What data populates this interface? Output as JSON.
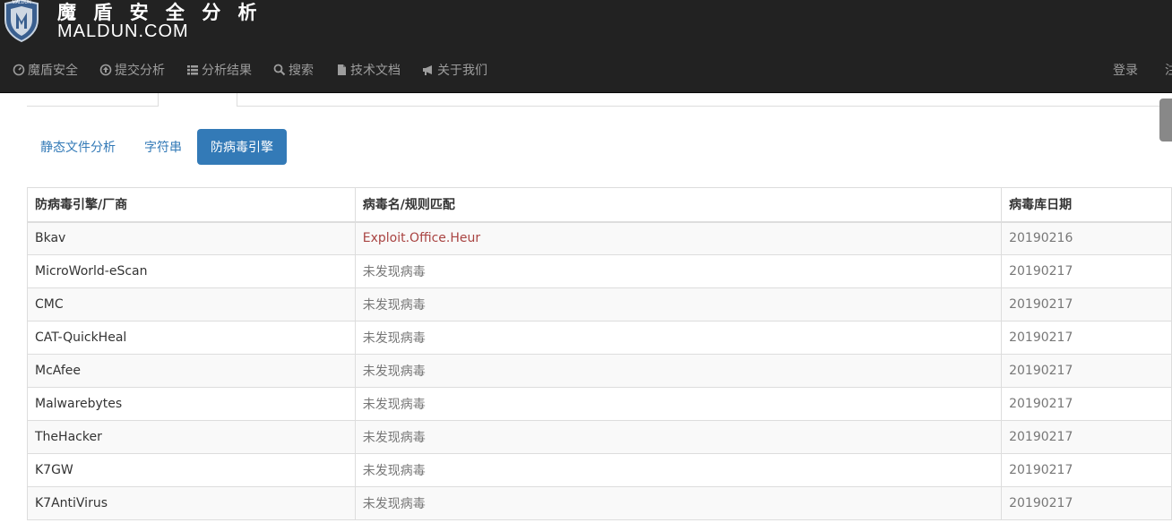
{
  "brand": {
    "logo_text": "MALDUN",
    "name_cn": "魔 盾 安 全 分 析",
    "name_en": "MALDUN.COM"
  },
  "nav": {
    "items": [
      {
        "label": "魔盾安全",
        "icon": "dashboard-icon"
      },
      {
        "label": "提交分析",
        "icon": "upload-circle-icon"
      },
      {
        "label": "分析结果",
        "icon": "list-icon"
      },
      {
        "label": "搜索",
        "icon": "search-icon"
      },
      {
        "label": "技术文档",
        "icon": "file-icon"
      },
      {
        "label": "关于我们",
        "icon": "bullhorn-icon"
      }
    ],
    "login": "登录",
    "register": "注"
  },
  "tabs": {
    "items": [
      {
        "label": "静态文件分析",
        "active": false
      },
      {
        "label": "字符串",
        "active": false
      },
      {
        "label": "防病毒引擎",
        "active": true
      }
    ]
  },
  "table": {
    "headers": [
      "防病毒引擎/厂商",
      "病毒名/规则匹配",
      "病毒库日期"
    ],
    "rows": [
      {
        "engine": "Bkav",
        "result": "Exploit.Office.Heur",
        "date": "20190216",
        "detected": true
      },
      {
        "engine": "MicroWorld-eScan",
        "result": "未发现病毒",
        "date": "20190217",
        "detected": false
      },
      {
        "engine": "CMC",
        "result": "未发现病毒",
        "date": "20190217",
        "detected": false
      },
      {
        "engine": "CAT-QuickHeal",
        "result": "未发现病毒",
        "date": "20190217",
        "detected": false
      },
      {
        "engine": "McAfee",
        "result": "未发现病毒",
        "date": "20190217",
        "detected": false
      },
      {
        "engine": "Malwarebytes",
        "result": "未发现病毒",
        "date": "20190217",
        "detected": false
      },
      {
        "engine": "TheHacker",
        "result": "未发现病毒",
        "date": "20190217",
        "detected": false
      },
      {
        "engine": "K7GW",
        "result": "未发现病毒",
        "date": "20190217",
        "detected": false
      },
      {
        "engine": "K7AntiVirus",
        "result": "未发现病毒",
        "date": "20190217",
        "detected": false
      }
    ]
  },
  "colors": {
    "navbar_bg": "#222222",
    "nav_text": "#9d9d9d",
    "accent": "#337ab7",
    "detected": "#a94442",
    "muted": "#777777"
  }
}
